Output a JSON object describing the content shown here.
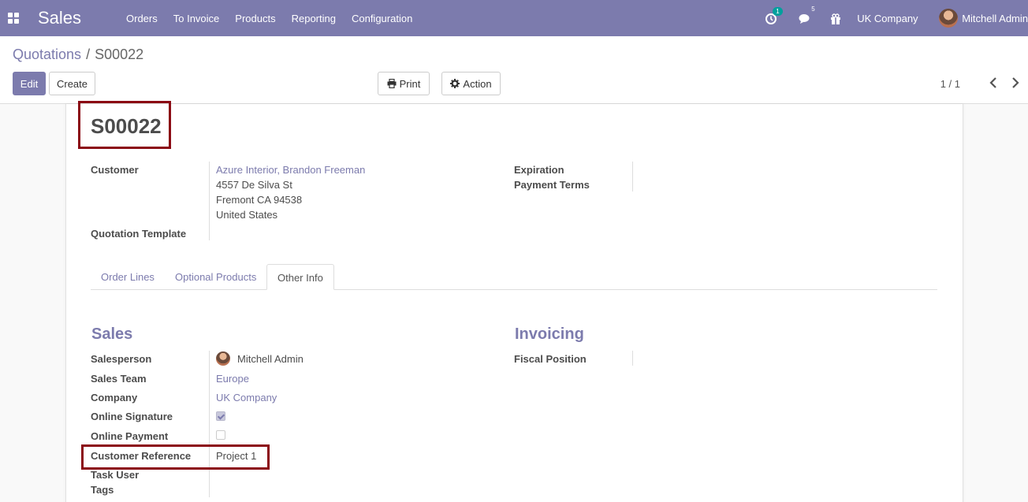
{
  "navbar": {
    "app_name": "Sales",
    "menu": [
      "Orders",
      "To Invoice",
      "Products",
      "Reporting",
      "Configuration"
    ],
    "activity_count": "1",
    "message_count": "5",
    "company": "UK Company",
    "user": "Mitchell Admin"
  },
  "breadcrumb": {
    "parent": "Quotations",
    "separator": "/",
    "current": "S00022"
  },
  "buttons": {
    "edit": "Edit",
    "create": "Create",
    "print": "Print",
    "action": "Action"
  },
  "pager": {
    "value": "1 / 1"
  },
  "form": {
    "title": "S00022",
    "customer_label": "Customer",
    "customer_name": "Azure Interior, Brandon Freeman",
    "address_line1": "4557 De Silva St",
    "address_line2": "Fremont CA 94538",
    "address_line3": "United States",
    "quotation_template_label": "Quotation Template",
    "expiration_label": "Expiration",
    "payment_terms_label": "Payment Terms"
  },
  "tabs": [
    "Order Lines",
    "Optional Products",
    "Other Info"
  ],
  "sales": {
    "title": "Sales",
    "salesperson_label": "Salesperson",
    "salesperson": "Mitchell Admin",
    "team_label": "Sales Team",
    "team": "Europe",
    "company_label": "Company",
    "company": "UK Company",
    "online_signature_label": "Online Signature",
    "online_signature": true,
    "online_payment_label": "Online Payment",
    "online_payment": false,
    "customer_reference_label": "Customer Reference",
    "customer_reference": "Project 1",
    "task_user_label": "Task User",
    "tags_label": "Tags"
  },
  "invoicing": {
    "title": "Invoicing",
    "fiscal_position_label": "Fiscal Position"
  },
  "colors": {
    "brand": "#7c7bad",
    "highlight": "#8b0a14",
    "badge": "#00a09d"
  }
}
